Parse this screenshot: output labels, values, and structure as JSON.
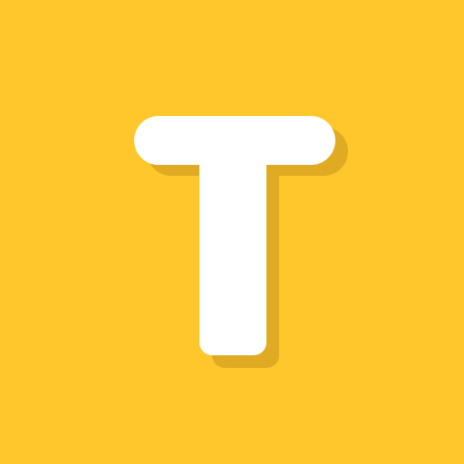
{
  "logo": {
    "letter": "T",
    "background_color": "#FFC72C",
    "letter_color": "#FFFFFF",
    "shadow_color": "#E0AA22",
    "icon_name": "letter-t-logo-icon"
  }
}
